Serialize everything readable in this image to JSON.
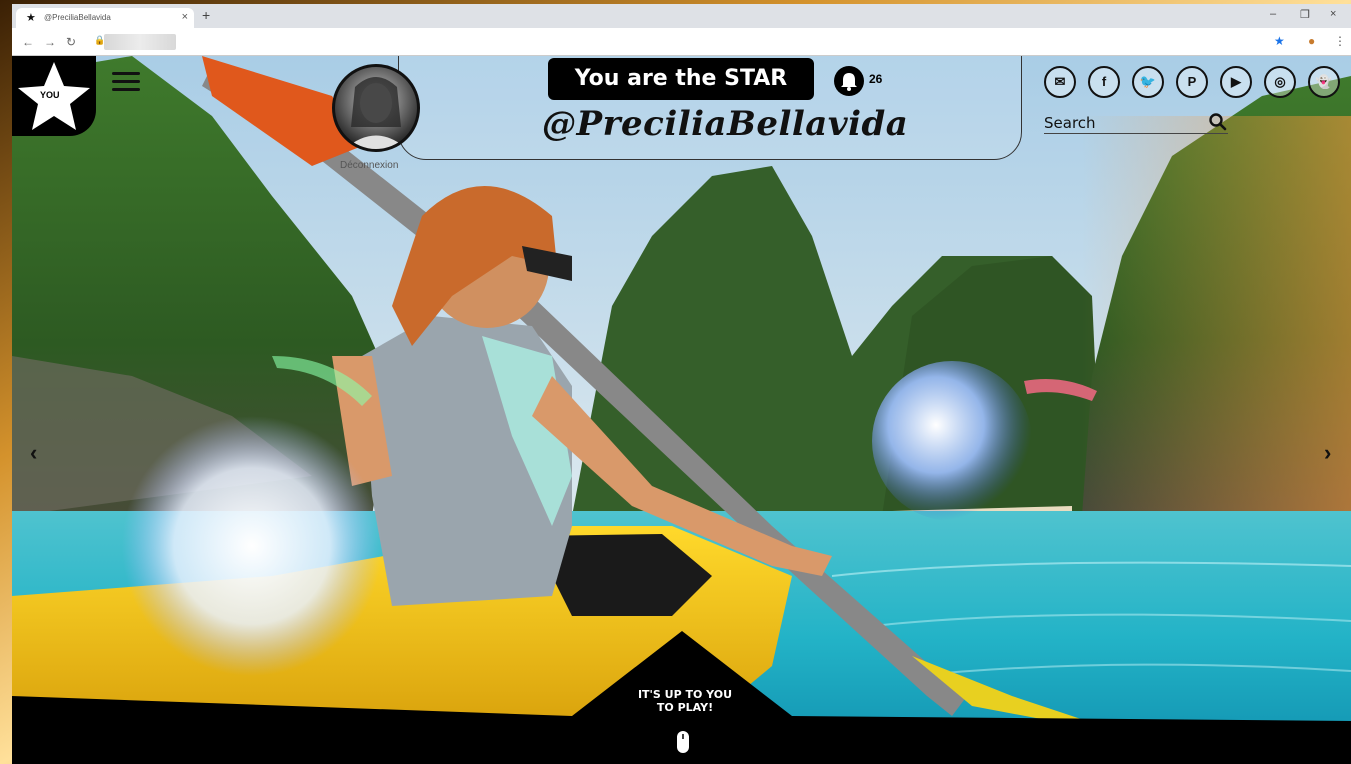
{
  "browser": {
    "tab_title": "@PreciliaBellavida",
    "tab_close": "×",
    "new_tab": "+",
    "window_controls": [
      "–",
      "❐",
      "×"
    ]
  },
  "header": {
    "tagline": "You are the STAR",
    "handle": "@PreciliaBellavida",
    "notification_count": "26",
    "logout_label": "Déconnexion",
    "badge_text": "YOU"
  },
  "social": [
    {
      "name": "mail-icon",
      "glyph": "✉"
    },
    {
      "name": "facebook-icon",
      "glyph": "f"
    },
    {
      "name": "twitter-icon",
      "glyph": "🐦"
    },
    {
      "name": "pinterest-icon",
      "glyph": "P"
    },
    {
      "name": "youtube-icon",
      "glyph": "▶"
    },
    {
      "name": "instagram-icon",
      "glyph": "◎"
    },
    {
      "name": "snapchat-icon",
      "glyph": "👻"
    }
  ],
  "search": {
    "placeholder": "Search"
  },
  "carousel": {
    "prev": "‹",
    "next": "›"
  },
  "cta": {
    "line1": "IT'S UP TO YOU",
    "line2": "TO PLAY!"
  },
  "colors": {
    "accent": "#000000",
    "water": "#1fb6c8",
    "kayak": "#f2c515"
  }
}
